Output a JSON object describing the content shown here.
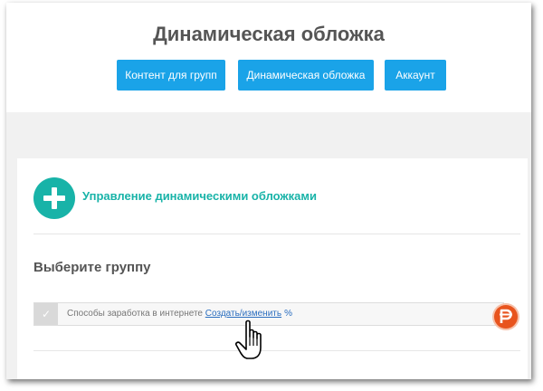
{
  "header": {
    "title": "Динамическая обложка",
    "nav": [
      {
        "label": "Контент для групп"
      },
      {
        "label": "Динамическая обложка"
      },
      {
        "label": "Аккаунт"
      }
    ]
  },
  "section": {
    "title": "Управление динамическими обложками",
    "icon": "plus-circle-icon",
    "accent_color": "#18b3a8"
  },
  "select_group": {
    "label": "Выберите группу",
    "group": {
      "name": "Способы заработка в интернете",
      "action_link": "Создать/изменить",
      "link_icon": "link-icon"
    }
  },
  "colors": {
    "button": "#1aa3e8",
    "logo": "#e8541e",
    "link": "#2a6ebf"
  }
}
